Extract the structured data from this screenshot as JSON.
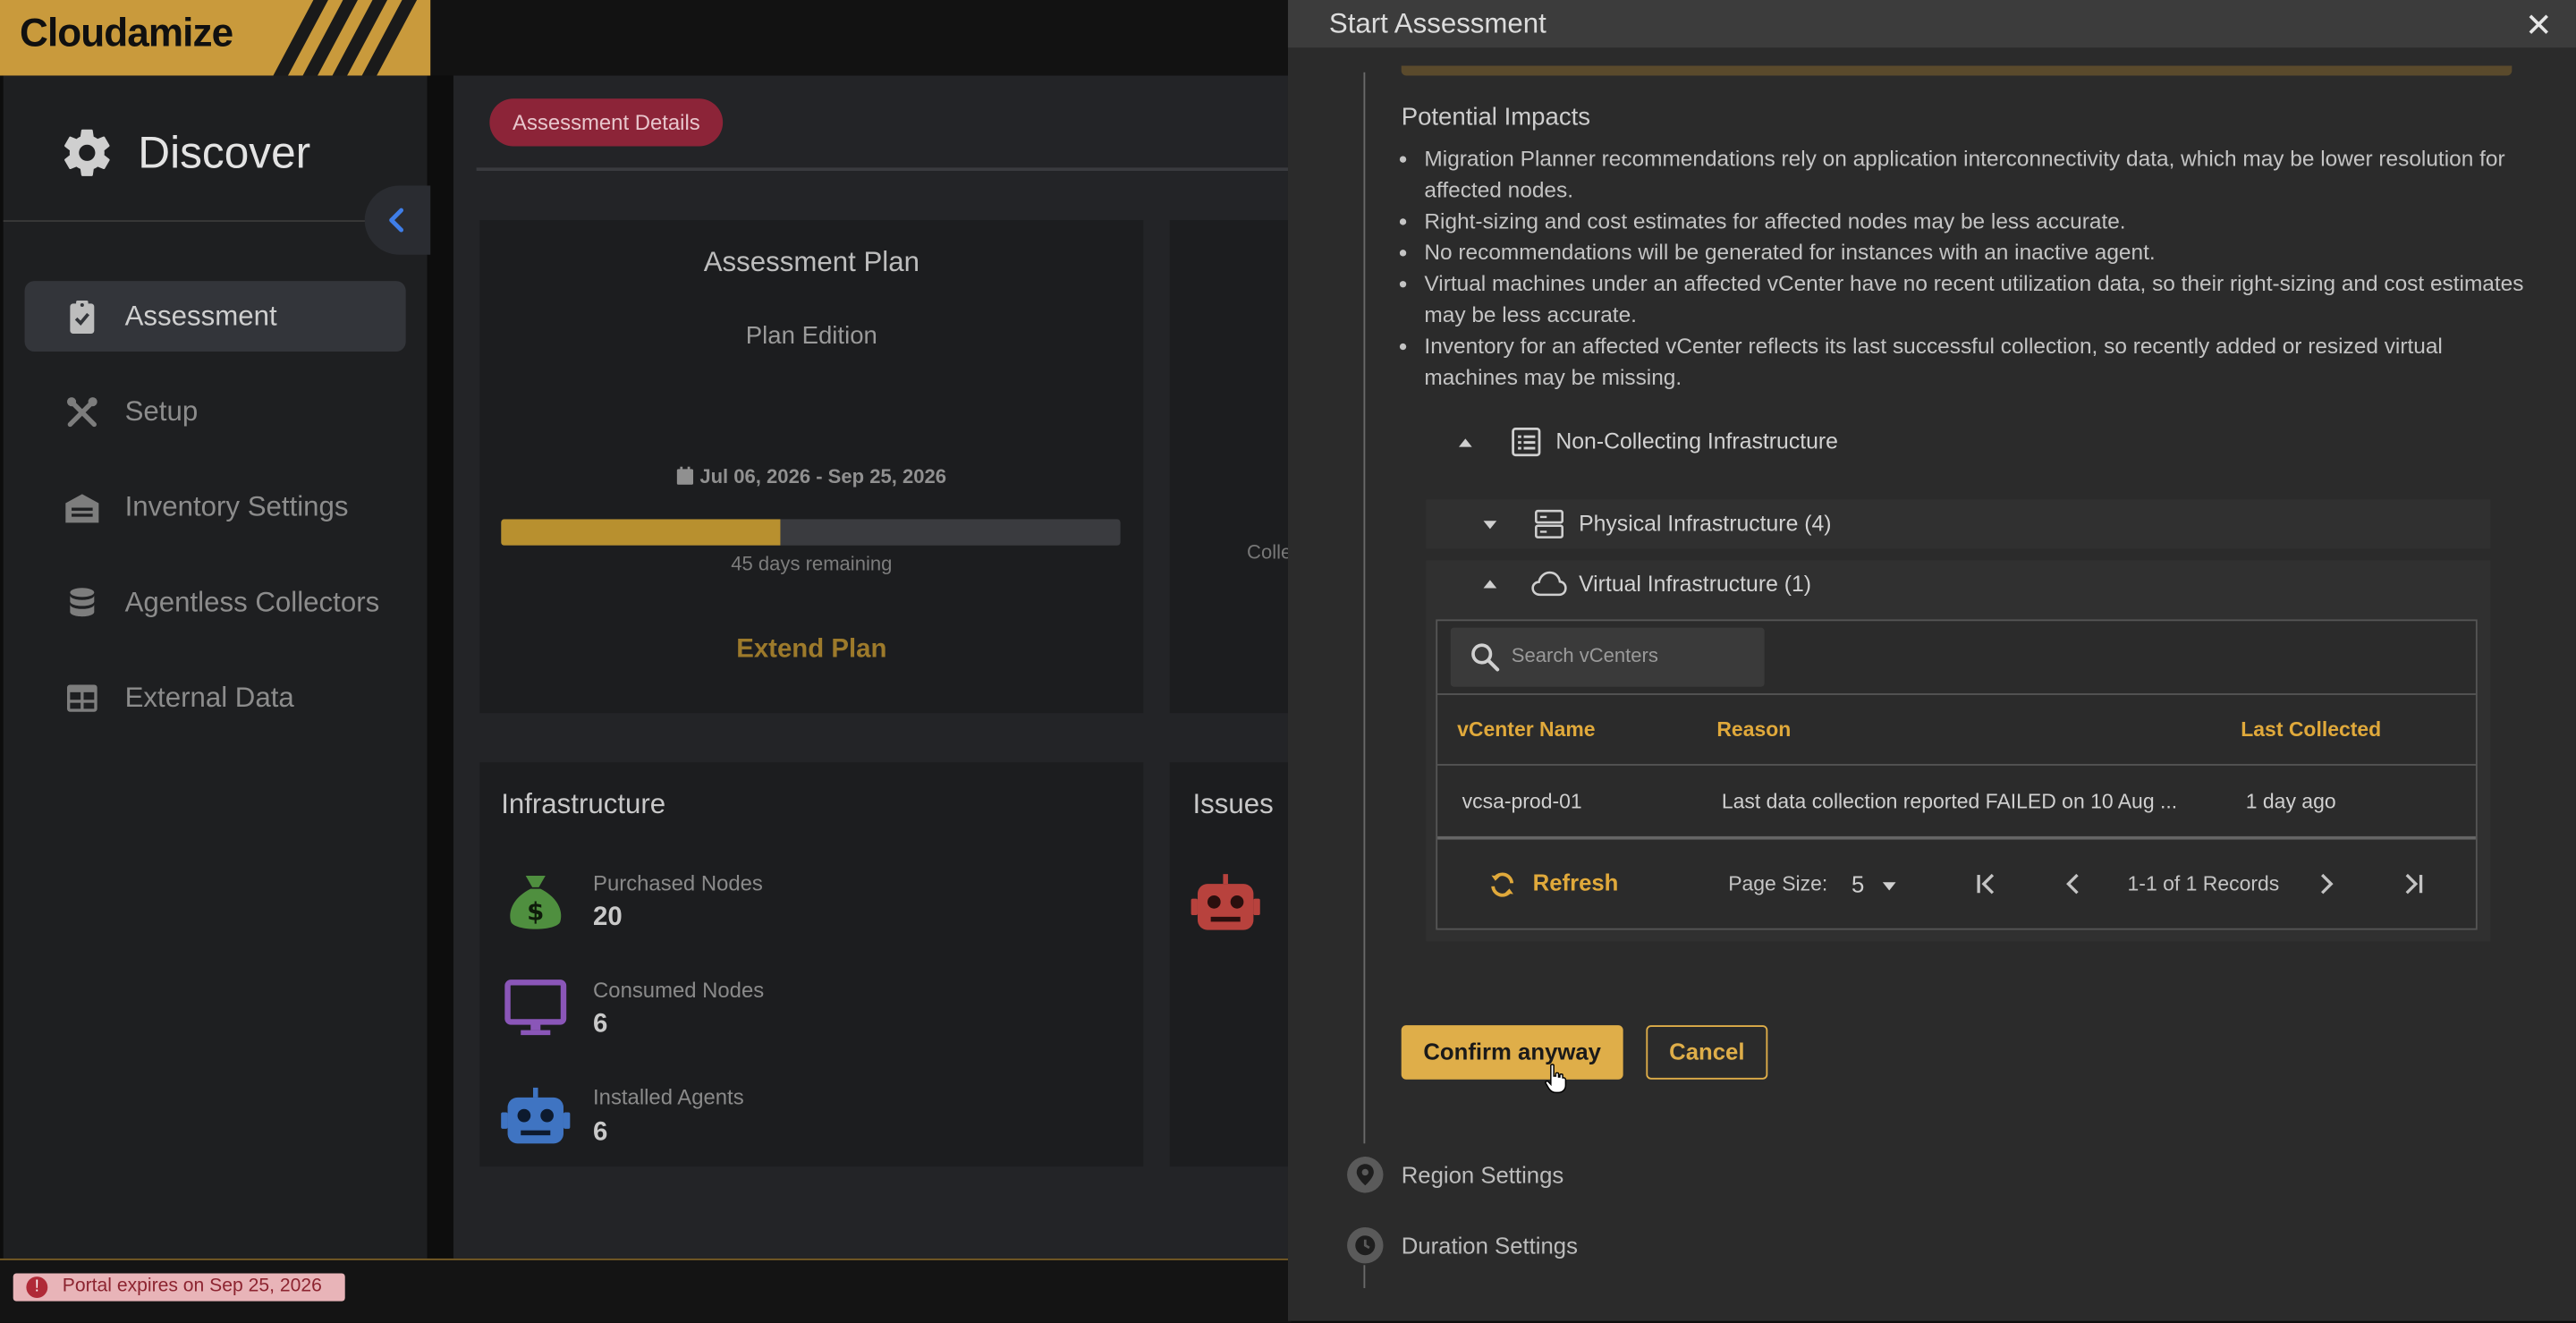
{
  "app": {
    "logo": "Cloudamize"
  },
  "sidebar": {
    "title": "Discover",
    "items": [
      {
        "label": "Assessment",
        "icon": "clipboard-check-icon",
        "active": true
      },
      {
        "label": "Setup",
        "icon": "tools-icon"
      },
      {
        "label": "Inventory Settings",
        "icon": "warehouse-icon"
      },
      {
        "label": "Agentless Collectors",
        "icon": "database-icon"
      },
      {
        "label": "External Data",
        "icon": "table-icon"
      }
    ]
  },
  "main": {
    "chip": "Assessment Details",
    "plan": {
      "title": "Assessment Plan",
      "edition": "Plan Edition",
      "dates": "Jul 06, 2026 - Sep 25, 2026",
      "progress": 0.45,
      "remaining": "45 days remaining",
      "extend": "Extend Plan"
    },
    "partial_text": "Colle",
    "infrastructure": {
      "title": "Infrastructure",
      "stats": [
        {
          "label": "Purchased Nodes",
          "value": "20",
          "color": "#4f8f3f"
        },
        {
          "label": "Consumed Nodes",
          "value": "6",
          "color": "#8a56b8"
        },
        {
          "label": "Installed Agents",
          "value": "6",
          "color": "#3f74c2"
        }
      ]
    },
    "issues": {
      "title": "Issues"
    }
  },
  "footer": {
    "expiry": "Portal expires on Sep 25, 2026"
  },
  "modal": {
    "title": "Start Assessment",
    "close": "✕",
    "impacts_title": "Potential Impacts",
    "impacts": [
      "Migration Planner recommendations rely on application interconnectivity data, which may be lower resolution for affected nodes.",
      "Right-sizing and cost estimates for affected nodes may be less accurate.",
      "No recommendations will be generated for instances with an inactive agent.",
      "Virtual machines under an affected vCenter have no recent utilization data, so their right-sizing and cost estimates may be less accurate.",
      "Inventory for an affected vCenter reflects its last successful collection, so recently added or resized virtual machines may be missing."
    ],
    "non_collecting": "Non-Collecting Infrastructure",
    "physical": "Physical Infrastructure (4)",
    "virtual": "Virtual Infrastructure (1)",
    "search_placeholder": "Search vCenters",
    "table": {
      "columns": [
        "vCenter Name",
        "Reason",
        "Last Collected"
      ],
      "rows": [
        {
          "name": "vcsa-prod-01",
          "reason": "Last data collection reported FAILED on 10 Aug ...",
          "last": "1 day ago"
        }
      ]
    },
    "pager": {
      "refresh": "Refresh",
      "page_size_label": "Page Size:",
      "page_size": "5",
      "records": "1-1 of 1 Records"
    },
    "confirm": "Confirm anyway",
    "cancel": "Cancel",
    "steps": [
      {
        "label": "Region Settings",
        "icon": "map-pin-icon"
      },
      {
        "label": "Duration Settings",
        "icon": "clock-icon"
      }
    ]
  }
}
